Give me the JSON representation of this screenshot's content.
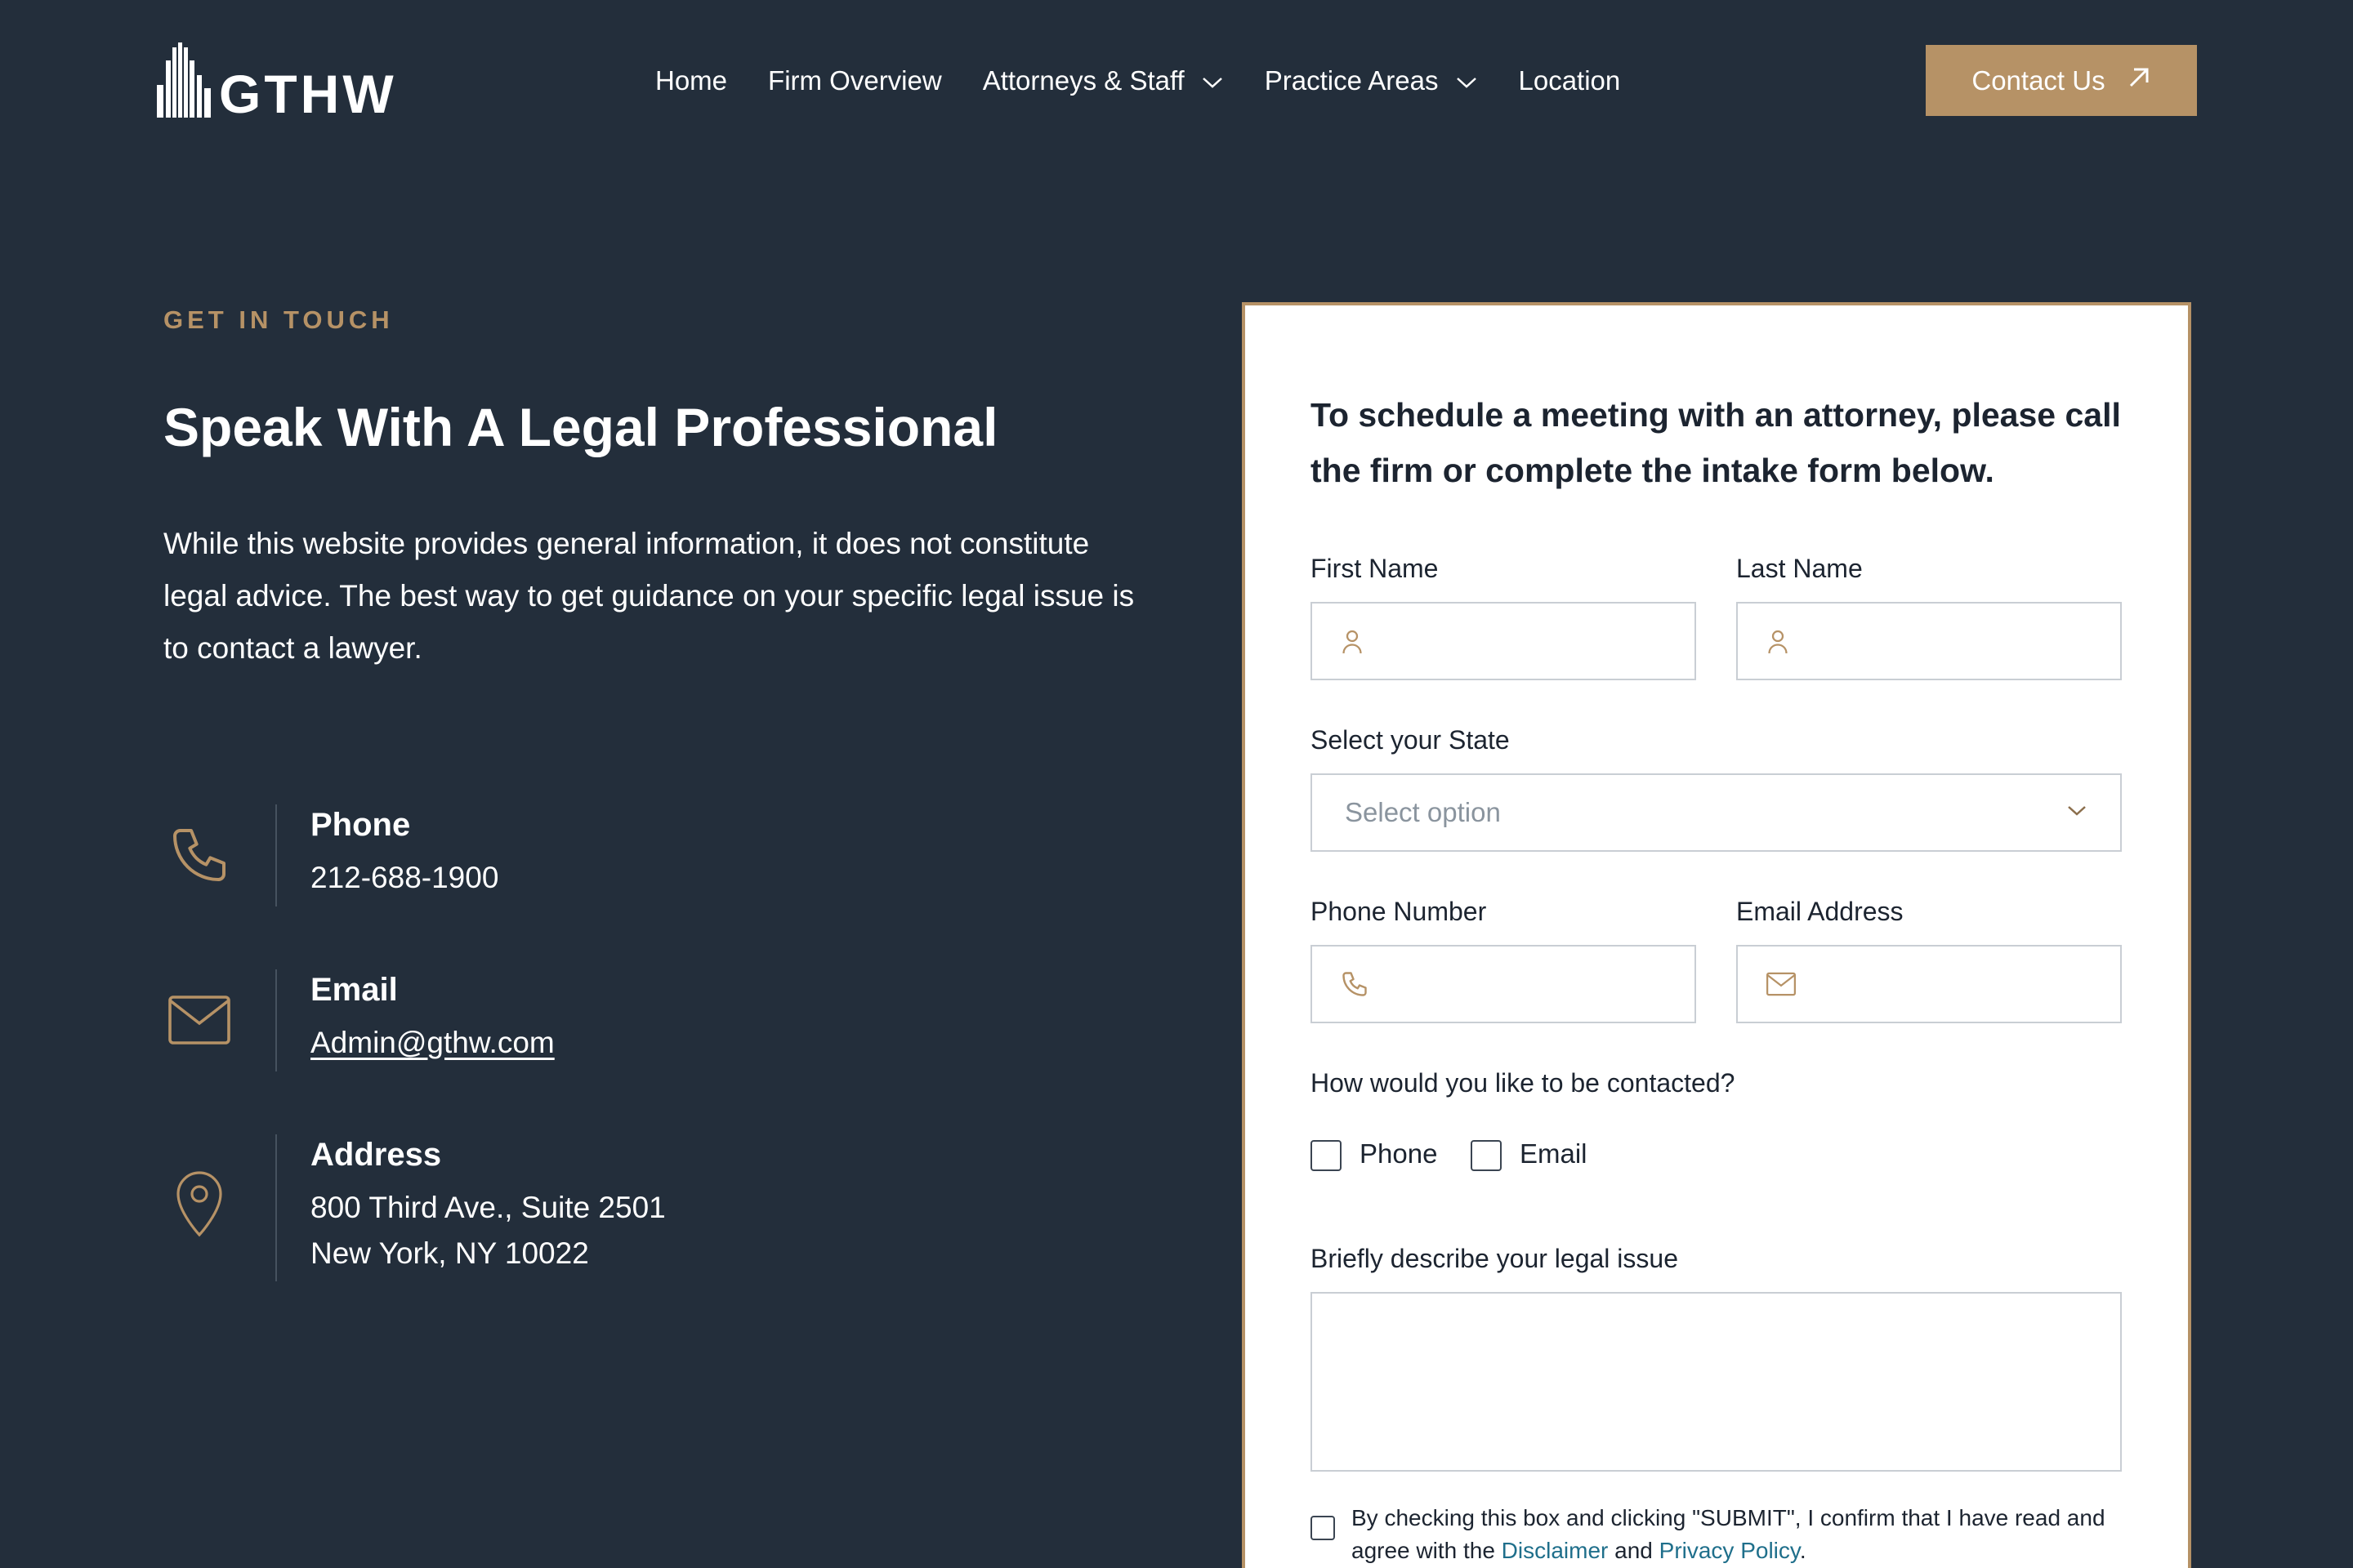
{
  "brand": {
    "name": "GTHW",
    "accent": "#b69266",
    "background": "#232e3b"
  },
  "nav": {
    "items": [
      {
        "label": "Home",
        "has_dropdown": false
      },
      {
        "label": "Firm Overview",
        "has_dropdown": false
      },
      {
        "label": "Attorneys & Staff",
        "has_dropdown": true
      },
      {
        "label": "Practice Areas",
        "has_dropdown": true
      },
      {
        "label": "Location",
        "has_dropdown": false
      }
    ],
    "cta_label": "Contact Us",
    "cta_icon": "arrow-up-right-icon"
  },
  "intro": {
    "eyebrow": "GET IN TOUCH",
    "title": "Speak With A Legal Professional",
    "body": "While this website provides general information, it does not constitute legal advice. The best way to get guidance on your specific legal issue is to contact a lawyer."
  },
  "contact": {
    "phone": {
      "label": "Phone",
      "value": "212-688-1900",
      "icon": "phone-icon"
    },
    "email": {
      "label": "Email",
      "value": "Admin@gthw.com",
      "icon": "mail-icon"
    },
    "address": {
      "label": "Address",
      "line1": "800 Third Ave., Suite 2501",
      "line2": "New York, NY 10022",
      "icon": "map-pin-icon"
    }
  },
  "form": {
    "heading": "To schedule a meeting with an attorney, please call the firm or complete the intake form below.",
    "first_name_label": "First Name",
    "last_name_label": "Last Name",
    "state_label": "Select your State",
    "state_placeholder": "Select option",
    "phone_label": "Phone Number",
    "email_label": "Email Address",
    "contact_method_label": "How would you like to be contacted?",
    "contact_options": [
      "Phone",
      "Email"
    ],
    "issue_label": "Briefly describe your legal issue",
    "consent_prefix": "By checking this box and clicking \"SUBMIT\", I confirm that I have read and agree with the ",
    "consent_disclaimer": "Disclaimer",
    "consent_and": " and ",
    "consent_privacy": "Privacy Policy",
    "consent_suffix": "."
  }
}
